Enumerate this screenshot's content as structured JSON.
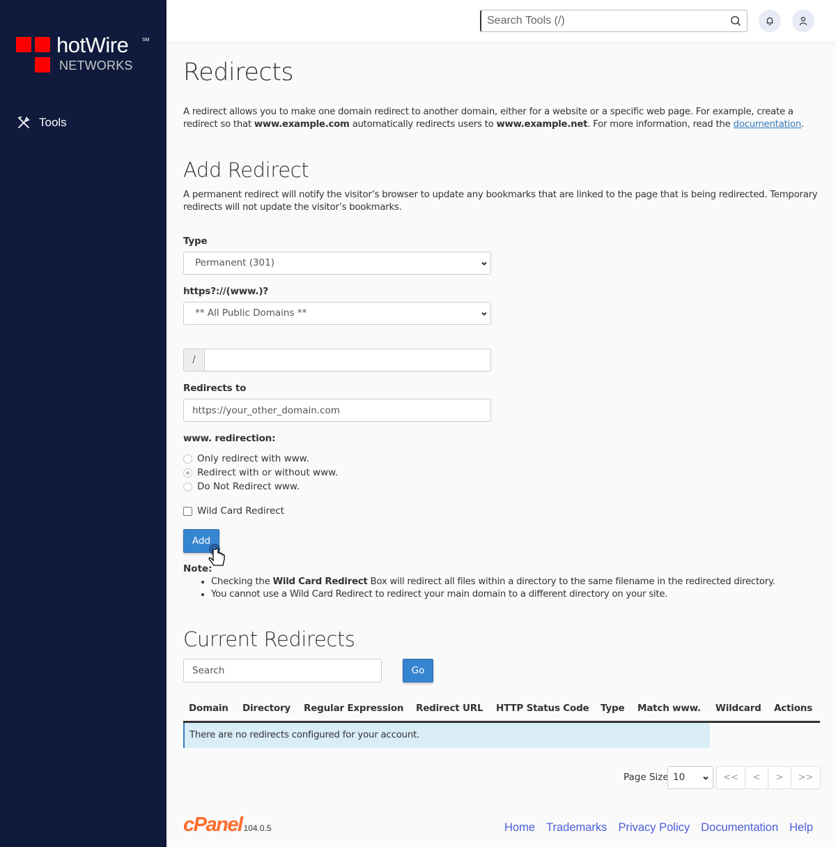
{
  "sidebar": {
    "logo": {
      "brand": "hotWire",
      "service_mark": "SM",
      "subtitle": "NETWORKS"
    },
    "nav": [
      {
        "label": "Tools",
        "icon": "tools-icon"
      }
    ]
  },
  "header": {
    "search_placeholder": "Search Tools (/)",
    "icons": [
      "search-icon",
      "bell-icon",
      "user-icon"
    ]
  },
  "page": {
    "title": "Redirects",
    "intro": {
      "part1": "A redirect allows you to make one domain redirect to another domain, either for a website or a specific web page. For example, create a redirect so that ",
      "bold1": "www.example.com",
      "part2": " automatically redirects users to ",
      "bold2": "www.example.net",
      "part3": ". For more information, read the ",
      "link": "documentation",
      "part4": "."
    }
  },
  "add_redirect": {
    "title": "Add Redirect",
    "description": "A permanent redirect will notify the visitor’s browser to update any bookmarks that are linked to the page that is being redirected. Temporary redirects will not update the visitor’s bookmarks.",
    "type_label": "Type",
    "type_value": "Permanent (301)",
    "domain_label": "https?://(www.)?",
    "domain_value": "** All Public Domains **",
    "path_prefix": "/",
    "path_value": "",
    "redirects_to_label": "Redirects to",
    "redirects_to_placeholder": "https://your_other_domain.com",
    "www_label": "www. redirection:",
    "www_options": [
      {
        "label": "Only redirect with www.",
        "checked": false
      },
      {
        "label": "Redirect with or without www.",
        "checked": true
      },
      {
        "label": "Do Not Redirect www.",
        "checked": false
      }
    ],
    "wildcard_label": "Wild Card Redirect",
    "wildcard_checked": false,
    "add_button": "Add",
    "note_title": "Note:",
    "notes": {
      "n1_pre": "Checking the ",
      "n1_bold": "Wild Card Redirect",
      "n1_post": " Box will redirect all files within a directory to the same filename in the redirected directory.",
      "n2": "You cannot use a Wild Card Redirect to redirect your main domain to a different directory on your site."
    }
  },
  "current_redirects": {
    "title": "Current Redirects",
    "search_placeholder": "Search",
    "go_button": "Go",
    "columns": [
      "Domain",
      "Directory",
      "Regular Expression",
      "Redirect URL",
      "HTTP Status Code",
      "Type",
      "Match www.",
      "Wildcard",
      "Actions"
    ],
    "empty_message": "There are no redirects configured for your account.",
    "page_size_label": "Page Size",
    "page_size_value": "10",
    "pager": {
      "first": "<<",
      "prev": "<",
      "next": ">",
      "last": ">>"
    }
  },
  "footer": {
    "brand": "cPanel",
    "version": "104.0.5",
    "links": [
      "Home",
      "Trademarks",
      "Privacy Policy",
      "Documentation",
      "Help"
    ]
  }
}
